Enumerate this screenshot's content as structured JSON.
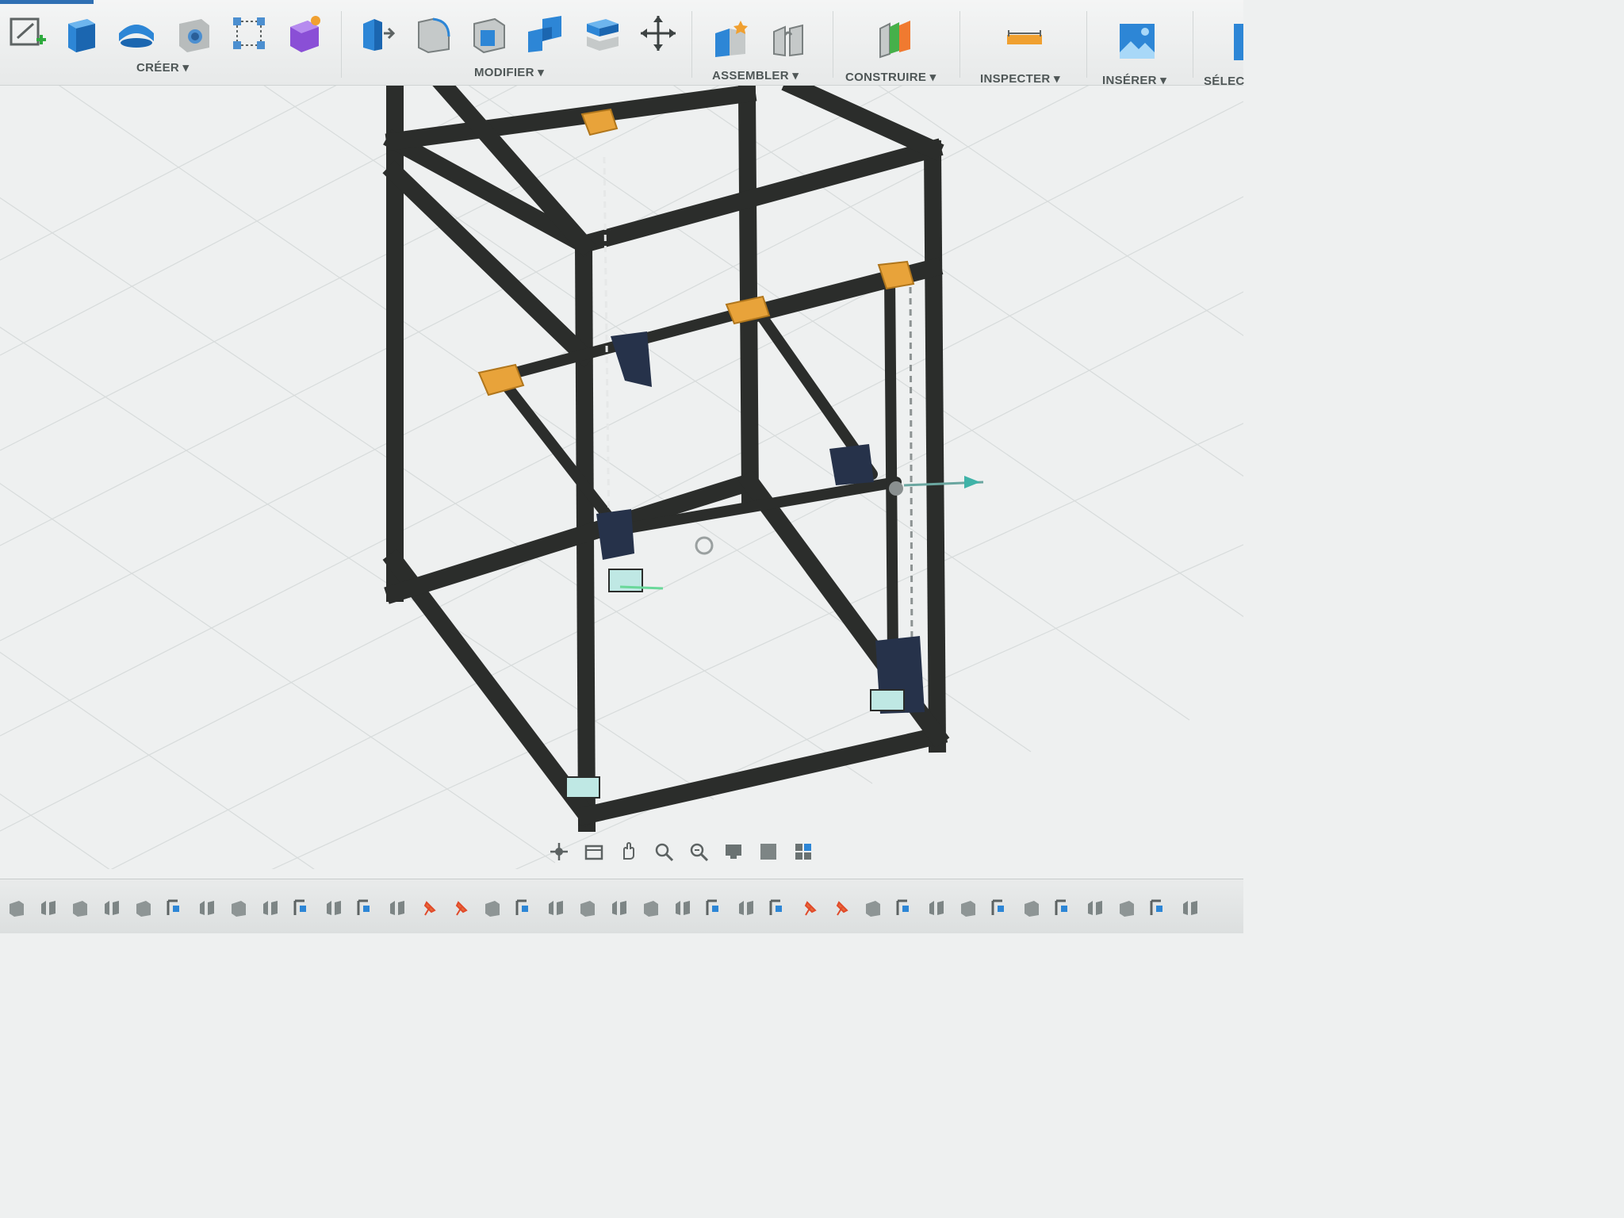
{
  "toolbar": {
    "groups": [
      {
        "label": "CRÉER ▾",
        "icons": [
          "sketch-icon",
          "extrude-icon",
          "revolve-icon",
          "hole-icon",
          "pattern-icon",
          "form-icon"
        ]
      },
      {
        "label": "MODIFIER ▾",
        "icons": [
          "press-pull-icon",
          "fillet-icon",
          "shell-icon",
          "combine-icon",
          "split-body-icon",
          "move-icon"
        ]
      },
      {
        "label": "ASSEMBLER ▾",
        "icons": [
          "new-component-icon",
          "joint-icon"
        ]
      },
      {
        "label": "CONSTRUIRE ▾",
        "icons": [
          "plane-icon"
        ]
      },
      {
        "label": "INSPECTER ▾",
        "icons": [
          "measure-icon"
        ]
      },
      {
        "label": "INSÉRER ▾",
        "icons": [
          "insert-image-icon"
        ]
      },
      {
        "label": "SÉLEC",
        "icons": [
          "select-icon"
        ]
      }
    ],
    "accent_color": "#2f6fb3"
  },
  "viewport": {
    "background": "#eef0f0",
    "grid_color": "#d5d9d9",
    "frame_color": "#2b2d2b",
    "bracket_color": "#e8a33a",
    "motor_color": "#26324a"
  },
  "nav_bar": {
    "items": [
      "orbit-icon",
      "look-at-icon",
      "pan-icon",
      "zoom-icon",
      "zoom-window-icon",
      "display-settings-icon",
      "visual-style-icon",
      "viewports-icon"
    ]
  },
  "timeline": {
    "item_count": 38
  }
}
